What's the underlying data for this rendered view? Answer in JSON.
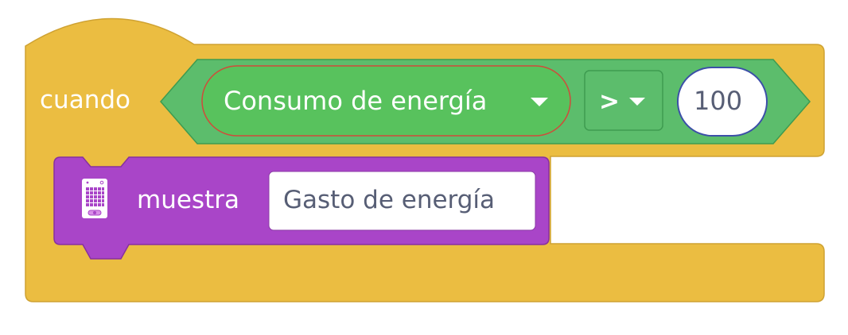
{
  "colors": {
    "event_block": "#EBBD41",
    "event_block_border": "#CFA232",
    "operator_block": "#5CBD6C",
    "operator_block_border": "#3E9B50",
    "sensor_reporter": "#58C25D",
    "sensor_reporter_border": "#D04B3A",
    "display_block": "#A945C8",
    "display_block_border": "#87309F",
    "input_text": "#575E75",
    "input_bg": "#FFFFFF"
  },
  "when_block": {
    "label": "cuando",
    "condition": {
      "sensor": "Consumo de energía",
      "operator": ">",
      "value": "100"
    }
  },
  "display_block": {
    "icon": "matrix-display-icon",
    "label": "muestra",
    "text_value": "Gasto de energía"
  },
  "icons": {
    "dropdown": "caret-down-icon"
  }
}
